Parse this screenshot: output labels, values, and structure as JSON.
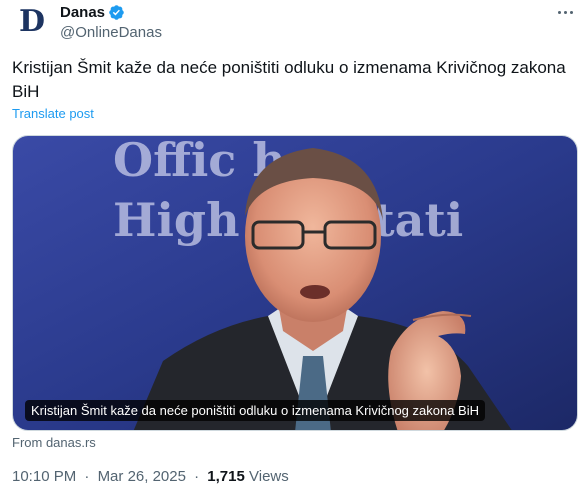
{
  "account": {
    "avatar_letter": "D",
    "display_name": "Danas",
    "handle": "@OnlineDanas",
    "verified": true
  },
  "post": {
    "text": "Kristijan Šmit kaže da neće poništiti odluku o izmenama Krivičnog zakona BiH",
    "translate_label": "Translate post"
  },
  "card": {
    "background_text_line1": "Offic  he",
    "background_text_line2": "High  esentati",
    "caption": "Kristijan Šmit kaže da neće poništiti odluku o izmenama Krivičnog zakona BiH",
    "source": "From danas.rs"
  },
  "meta": {
    "time": "10:10 PM",
    "date": "Mar 26, 2025",
    "separator": "·",
    "views_count": "1,715",
    "views_label": "Views"
  },
  "colors": {
    "accent": "#1d9bf0",
    "backdrop": "#2a3a8c",
    "secondary_text": "#536471"
  }
}
